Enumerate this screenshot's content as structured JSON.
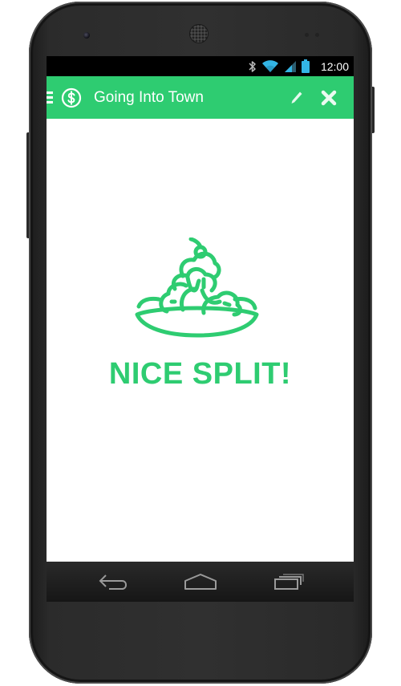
{
  "status_bar": {
    "time": "12:00",
    "icons": [
      "bluetooth-icon",
      "wifi-icon",
      "signal-icon",
      "battery-icon"
    ]
  },
  "action_bar": {
    "icon": "dollar-coin-icon",
    "title": "Going Into Town",
    "actions": [
      "edit-icon",
      "close-icon"
    ]
  },
  "content": {
    "illustration": "sundae-icon",
    "message": "NICE SPLIT!"
  },
  "nav_bar": {
    "buttons": [
      "back-icon",
      "home-icon",
      "recent-apps-icon"
    ]
  },
  "colors": {
    "accent": "#2ecc71",
    "status_icon": "#33b5e5",
    "nav_icon": "#9a9a9a"
  }
}
